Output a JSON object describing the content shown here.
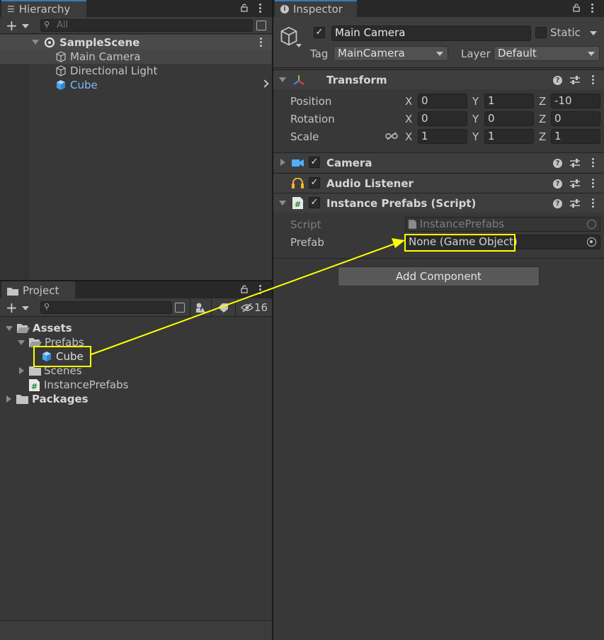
{
  "hierarchy": {
    "tab_label": "Hierarchy",
    "search_placeholder": "All",
    "scene_name": "SampleScene",
    "items": [
      {
        "label": "Main Camera"
      },
      {
        "label": "Directional Light"
      },
      {
        "label": "Cube"
      }
    ]
  },
  "project": {
    "tab_label": "Project",
    "hidden_count": "16",
    "tree": {
      "assets": "Assets",
      "prefabs": "Prefabs",
      "cube": "Cube",
      "scenes": "Scenes",
      "script": "InstancePrefabs",
      "packages": "Packages"
    }
  },
  "inspector": {
    "tab_label": "Inspector",
    "object_name": "Main Camera",
    "static_label": "Static",
    "tag_label": "Tag",
    "tag_value": "MainCamera",
    "layer_label": "Layer",
    "layer_value": "Default",
    "transform": {
      "title": "Transform",
      "position_label": "Position",
      "rotation_label": "Rotation",
      "scale_label": "Scale",
      "axis_x": "X",
      "axis_y": "Y",
      "axis_z": "Z",
      "position": {
        "x": "0",
        "y": "1",
        "z": "-10"
      },
      "rotation": {
        "x": "0",
        "y": "0",
        "z": "0"
      },
      "scale": {
        "x": "1",
        "y": "1",
        "z": "1"
      }
    },
    "camera_title": "Camera",
    "audio_title": "Audio Listener",
    "script_component": {
      "title": "Instance Prefabs (Script)",
      "script_label": "Script",
      "script_value": "InstancePrefabs",
      "prefab_label": "Prefab",
      "prefab_value": "None (Game Object)"
    },
    "add_component_label": "Add Component"
  },
  "colors": {
    "highlight": "#ffff00",
    "selection_blue": "#7cb7ff",
    "accent_tab": "#3a79bb"
  }
}
